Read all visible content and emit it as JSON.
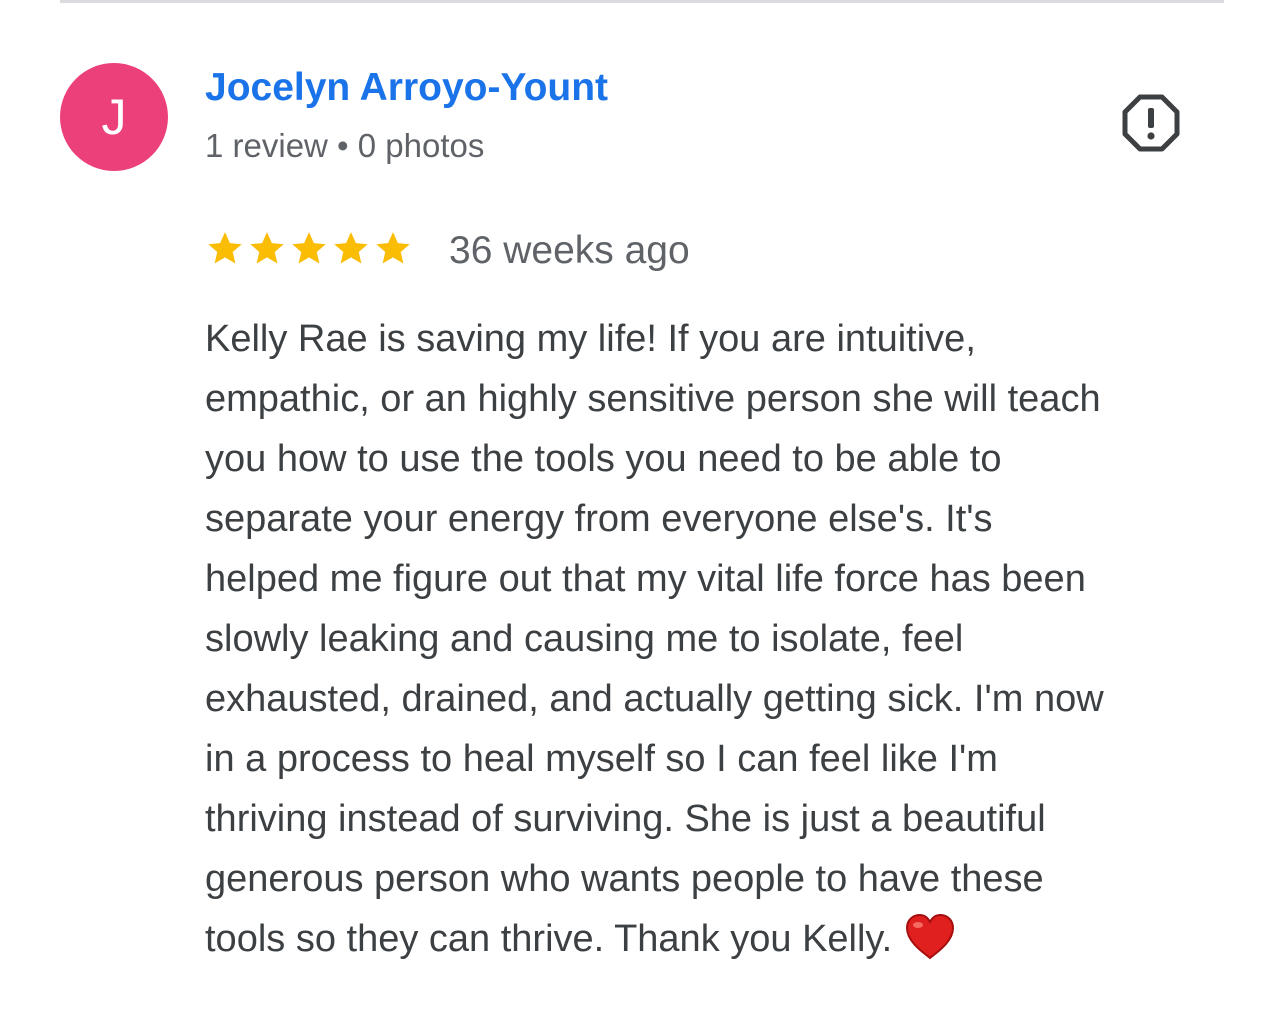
{
  "reviewer": {
    "avatar_initial": "J",
    "avatar_color": "#ec407a",
    "name": "Jocelyn Arroyo-Yount",
    "name_color": "#1a73e8",
    "meta": "1 review • 0 photos"
  },
  "report_icon": "flag-report-icon",
  "review": {
    "rating": 5,
    "rating_max": 5,
    "star_color": "#fbbc04",
    "date": "36 weeks ago",
    "text_lines": [
      "Kelly Rae is saving my life! If you are intuitive,",
      "empathic, or an highly sensitive person she will teach",
      "you how to use the tools you need to be able to",
      "separate your energy from everyone else's. It's",
      "helped me figure out that my vital life force has been",
      "slowly leaking and causing me to isolate, feel",
      "exhausted, drained, and actually getting sick. I'm now",
      "in a process to heal myself so I can feel like I'm",
      "thriving instead of surviving. She is just a beautiful",
      "generous person who wants people to have these",
      "tools so they can thrive. Thank you Kelly."
    ],
    "trailing_emoji": "red-heart-icon"
  }
}
